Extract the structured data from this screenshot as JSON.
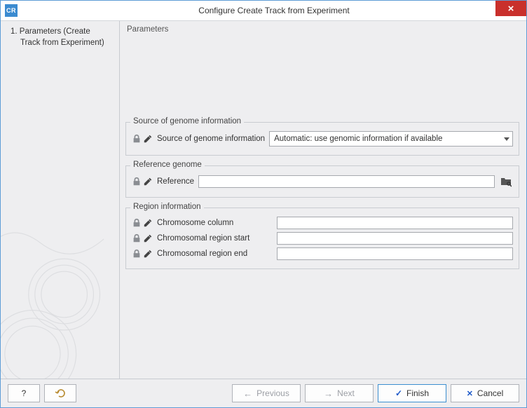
{
  "titlebar": {
    "app_icon_text": "CR",
    "title": "Configure Create Track from Experiment"
  },
  "sidebar": {
    "step1": "1.  Parameters (Create Track from Experiment)"
  },
  "main": {
    "heading": "Parameters",
    "source_group": {
      "legend": "Source of genome information",
      "label": "Source of genome information",
      "value": "Automatic: use genomic information if available"
    },
    "reference_group": {
      "legend": "Reference genome",
      "label": "Reference",
      "value": ""
    },
    "region_group": {
      "legend": "Region information",
      "chrom_col_label": "Chromosome column",
      "chrom_col_value": "",
      "region_start_label": "Chromosomal region start",
      "region_start_value": "",
      "region_end_label": "Chromosomal region end",
      "region_end_value": ""
    }
  },
  "footer": {
    "help": "?",
    "previous": "Previous",
    "next": "Next",
    "finish": "Finish",
    "cancel": "Cancel"
  }
}
